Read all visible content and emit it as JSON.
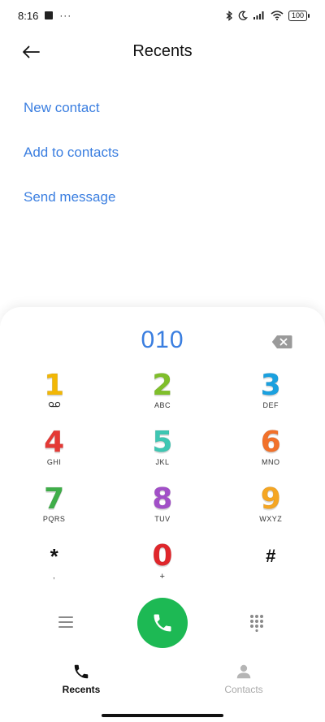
{
  "status_bar": {
    "time": "8:16",
    "dots": "···",
    "battery": "100"
  },
  "header": {
    "title": "Recents",
    "back_icon": "arrow-left-icon"
  },
  "actions": [
    {
      "label": "New contact"
    },
    {
      "label": "Add to contacts"
    },
    {
      "label": "Send message"
    }
  ],
  "dialer": {
    "number": "010",
    "keys": [
      [
        {
          "digit": "1",
          "sub": "",
          "color": "#f2b705"
        },
        {
          "digit": "2",
          "sub": "ABC",
          "color": "#7fbf2a"
        },
        {
          "digit": "3",
          "sub": "DEF",
          "color": "#1aa1e0"
        }
      ],
      [
        {
          "digit": "4",
          "sub": "GHI",
          "color": "#e53935"
        },
        {
          "digit": "5",
          "sub": "JKL",
          "color": "#3ec7b3"
        },
        {
          "digit": "6",
          "sub": "MNO",
          "color": "#f2712a"
        }
      ],
      [
        {
          "digit": "7",
          "sub": "PQRS",
          "color": "#3fae49"
        },
        {
          "digit": "8",
          "sub": "TUV",
          "color": "#a24fc8"
        },
        {
          "digit": "9",
          "sub": "WXYZ",
          "color": "#f5a623"
        }
      ],
      [
        {
          "digit": "*",
          "sub": ",",
          "color": "#111111"
        },
        {
          "digit": "0",
          "sub": "+",
          "color": "#e0262b"
        },
        {
          "digit": "#",
          "sub": "",
          "color": "#111111"
        }
      ]
    ],
    "call_color": "#1db954",
    "accent": "#3a7ee0"
  },
  "tabs": [
    {
      "label": "Recents",
      "icon": "phone-icon",
      "active": true
    },
    {
      "label": "Contacts",
      "icon": "person-icon",
      "active": false
    }
  ]
}
